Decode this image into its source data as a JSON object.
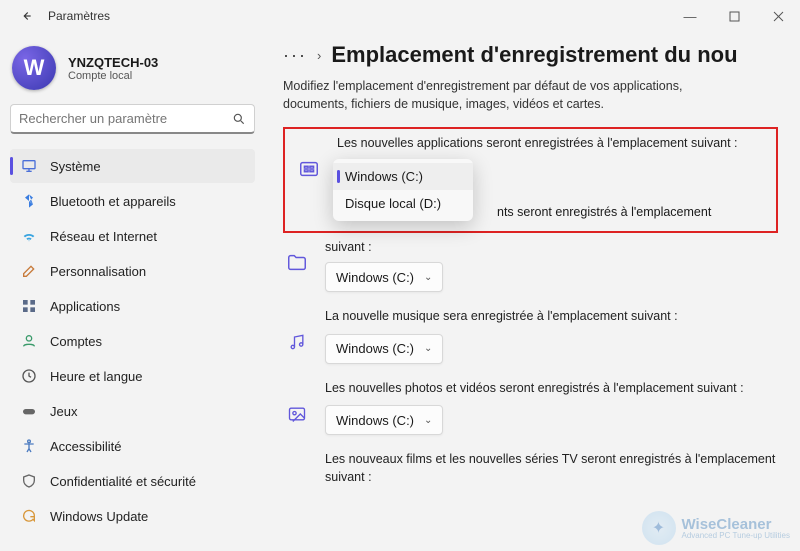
{
  "window": {
    "title": "Paramètres",
    "minimize": "—",
    "maximize": "▢",
    "close": "✕"
  },
  "user": {
    "initial": "W",
    "name": "YNZQTECH-03",
    "type": "Compte local"
  },
  "search": {
    "placeholder": "Rechercher un paramètre"
  },
  "nav": {
    "items": [
      {
        "label": "Système",
        "icon": "system"
      },
      {
        "label": "Bluetooth et appareils",
        "icon": "bluetooth"
      },
      {
        "label": "Réseau et Internet",
        "icon": "wifi"
      },
      {
        "label": "Personnalisation",
        "icon": "brush"
      },
      {
        "label": "Applications",
        "icon": "apps"
      },
      {
        "label": "Comptes",
        "icon": "person"
      },
      {
        "label": "Heure et langue",
        "icon": "clock"
      },
      {
        "label": "Jeux",
        "icon": "gamepad"
      },
      {
        "label": "Accessibilité",
        "icon": "accessibility"
      },
      {
        "label": "Confidentialité et sécurité",
        "icon": "shield"
      },
      {
        "label": "Windows Update",
        "icon": "update"
      }
    ],
    "active_index": 0
  },
  "breadcrumb": {
    "ellipsis": "···",
    "chevron": "›",
    "heading": "Emplacement d'enregistrement du nou"
  },
  "lead": "Modifiez l'emplacement d'enregistrement par défaut de vos applications, documents, fichiers de musique, images, vidéos et cartes.",
  "settings": {
    "apps": {
      "label": "Les nouvelles applications seront enregistrées à l'emplacement suivant :",
      "value": "Windows (C:)",
      "options": [
        "Windows (C:)",
        "Disque local (D:)"
      ]
    },
    "docs": {
      "partial_label": "nts seront enregistrés à l'emplacement",
      "label_below": "suivant :",
      "value": "Windows (C:)"
    },
    "music": {
      "label": "La nouvelle musique sera enregistrée à l'emplacement suivant :",
      "value": "Windows (C:)"
    },
    "photos": {
      "label": "Les nouvelles photos et vidéos seront enregistrés à l'emplacement suivant :",
      "value": "Windows (C:)"
    },
    "tv": {
      "label": "Les nouveaux films et les nouvelles séries TV seront enregistrés à l'emplacement suivant :"
    }
  },
  "watermark": {
    "brand": "WiseCleaner",
    "tag": "Advanced PC Tune-up Utilities"
  }
}
